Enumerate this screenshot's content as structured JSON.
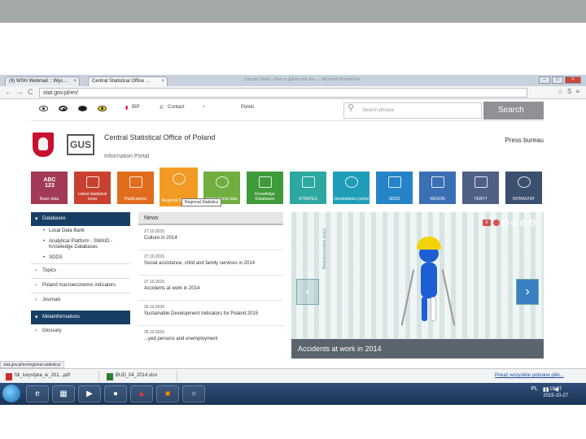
{
  "browser": {
    "tabs": [
      {
        "label": "(9) WSH Webmail :: Wys…",
        "close": "×"
      },
      {
        "label": "Central Statistical Office …",
        "close": "×"
      }
    ],
    "ghost_title": "Sample Slides - How to gather and use... - Microsoft PowerPoint",
    "url": "stat.gov.pl/en/",
    "back": "←",
    "forward": "→",
    "reload": "C",
    "window_buttons": [
      "–",
      "□",
      "×"
    ]
  },
  "site": {
    "util": {
      "bip": "BIP",
      "contact": "Contact",
      "polski": "Polski",
      "search_placeholder": "Search phrase",
      "search_button": "Search"
    },
    "brand": {
      "logo_text": "GUS",
      "title": "Central Statistical Office of Poland",
      "subtitle": "Information Portal",
      "press_bureau": "Press bureau"
    },
    "tiles": [
      {
        "label": "Basic data",
        "icon": "abc-123-icon",
        "abc": "ABC 123",
        "color": "#a23a55"
      },
      {
        "label": "Latest statistical news",
        "icon": "news-icon",
        "color": "#c8412f"
      },
      {
        "label": "Publications",
        "icon": "book-icon",
        "color": "#e16c1e"
      },
      {
        "label": "Regional Statistics",
        "icon": "people-icon",
        "color": "#f39a25"
      },
      {
        "label": "International data",
        "icon": "globe-icon",
        "color": "#6fae3f"
      },
      {
        "label": "Knowledge Databases",
        "icon": "database-icon",
        "color": "#3f9a3a"
      },
      {
        "label": "STRATEG",
        "icon": "strateg-icon",
        "color": "#2da8a0"
      },
      {
        "label": "Geostatistics portal",
        "icon": "map-pie-icon",
        "color": "#1f9db8"
      },
      {
        "label": "SDDS",
        "icon": "grid-icon",
        "color": "#2584c8"
      },
      {
        "label": "REGON",
        "icon": "form-icon",
        "color": "#3b6fb4"
      },
      {
        "label": "TERYT",
        "icon": "poland-map-icon",
        "color": "#4f5f86"
      },
      {
        "label": "INTRASTAT",
        "icon": "stars-icon",
        "color": "#3b4f6e"
      }
    ],
    "tooltip": "Regional Statistics",
    "sidebar": {
      "databases_header": "Databases",
      "databases": [
        "Local Data Bank",
        "Analytical Platform - SWAID - Knowledge Databases",
        "SDDS"
      ],
      "items": [
        "Topics",
        "Poland macroeconomic indicators",
        "Journals"
      ],
      "metainfo_header": "Metainformations",
      "metainfo": [
        "Glossary"
      ]
    },
    "news": {
      "header": "News",
      "items": [
        {
          "date": "27.10.2015",
          "title": "Culture in 2014"
        },
        {
          "date": "27.10.2015",
          "title": "Social assistance, child and family services in 2014"
        },
        {
          "date": "27.10.2015",
          "title": "Accidents at work in 2014"
        },
        {
          "date": "26.10.2015",
          "title": "Sustainable Development Indicators for Poland 2015"
        },
        {
          "date": "26.10.2015",
          "title": "...yed persons and unemployment"
        }
      ]
    },
    "slider": {
      "caption": "Accidents at work in 2014",
      "vertical_text": "Bezpieczenstwo pracy",
      "prev": "‹",
      "next": "›",
      "counter": "6"
    }
  },
  "status_url": "stat.gov.pl/en/regional-statistics/",
  "downloads": [
    {
      "name": "fdi_turystyka_w_201...pdf",
      "type": "pdf"
    },
    {
      "name": "BUD_04_2014.xlsx",
      "type": "xls"
    }
  ],
  "downloads_showall": "Pokaż wszystkie pobrane pliki...",
  "taskbar": {
    "apps": [
      "e",
      "▦",
      "▶",
      "●",
      "▲",
      "■",
      "○"
    ],
    "tray": "PL",
    "time": "19:07",
    "date": "2015-10-27"
  }
}
